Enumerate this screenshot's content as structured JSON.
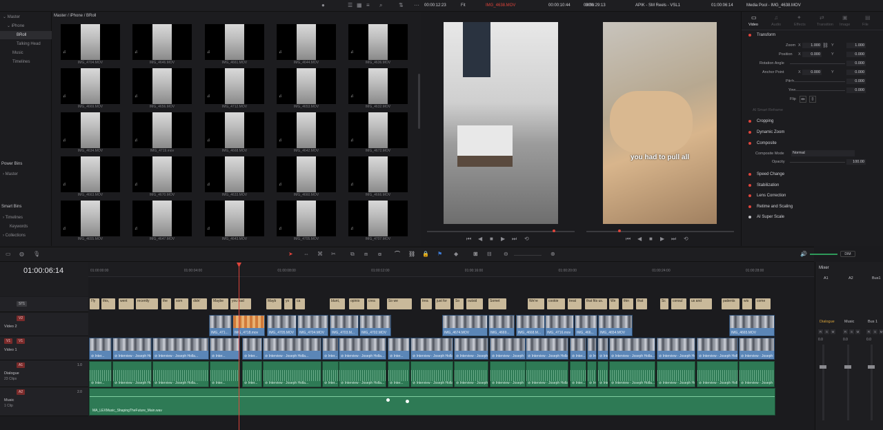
{
  "topbar": {
    "left_timecode": "00:00:12:23",
    "left_clip": "IMG_4638.MOV",
    "left_duration": "00:00:10:44",
    "fit_label": "Fit",
    "right_timecode": "00:00:29:13",
    "zoom": "30%",
    "timeline_name": "APIK - SM Reels - VSL1",
    "right_duration": "01:00:06:14",
    "inspector_title": "Media Pool - IMG_4638.MOV"
  },
  "sidebar": {
    "items": [
      {
        "label": "Master",
        "indent": 0
      },
      {
        "label": "iPhone",
        "indent": 1
      },
      {
        "label": "BRoll",
        "indent": 2,
        "selected": true
      },
      {
        "label": "Talking Head",
        "indent": 2
      },
      {
        "label": "Music",
        "indent": 1
      },
      {
        "label": "Timelines",
        "indent": 1
      }
    ],
    "power_bins_title": "Power Bins",
    "power_bins_items": [
      "Master"
    ],
    "smart_bins_title": "Smart Bins",
    "smart_bins_items": [
      "Timelines",
      "Keywords",
      "Collections"
    ]
  },
  "media_pool": {
    "breadcrumb": "Master / iPhone / BRoll",
    "clips": [
      "IMG_4704.MOV",
      "IMG_4646.MOV",
      "IMG_4661.MOV",
      "IMG_4644.MOV",
      "IMG_4636.MOV",
      "IMG_4669.MOV",
      "IMG_4656.MOV",
      "IMG_4712.MOV",
      "IMG_4653.MOV",
      "IMG_4632.MOV",
      "IMG_4634.MOV",
      "IMG_4719.mov",
      "IMG_4668.MOV",
      "IMG_4642.MOV",
      "IMG_4672.MOV",
      "IMG_4663.MOV",
      "IMG_4670.MOV",
      "IMG_4633.MOV",
      "IMG_4660.MOV",
      "IMG_4666.MOV",
      "IMG_4655.MOV",
      "IMG_4647.MOV",
      "IMG_4643.MOV",
      "IMG_4705.MOV",
      "IMG_4707.MOV"
    ]
  },
  "viewer": {
    "subtitle_overlay": "you had to pull all"
  },
  "inspector": {
    "tabs": [
      "Video",
      "Audio",
      "Effects",
      "Transition",
      "Image",
      "File"
    ],
    "transform_title": "Transform",
    "zoom_label": "Zoom",
    "zoom_x": "1.000",
    "zoom_y": "1.000",
    "position_label": "Position",
    "position_x": "0.000",
    "position_y": "0.000",
    "rotation_label": "Rotation Angle",
    "rotation_val": "0.000",
    "anchor_label": "Anchor Point",
    "anchor_x": "0.000",
    "anchor_y": "0.000",
    "pitch_label": "Pitch",
    "pitch_val": "0.000",
    "yaw_label": "Yaw",
    "yaw_val": "0.000",
    "flip_label": "Flip",
    "ai_smart_reframe": "AI Smart Reframe",
    "cropping": "Cropping",
    "dynamic_zoom": "Dynamic Zoom",
    "composite": "Composite",
    "composite_mode_label": "Composite Mode",
    "composite_mode_val": "Normal",
    "opacity_label": "Opacity",
    "opacity_val": "100.00",
    "speed_change": "Speed Change",
    "stabilization": "Stabilization",
    "lens_correction": "Lens Correction",
    "retime_scaling": "Retime and Scaling",
    "ai_super_scale": "AI Super Scale"
  },
  "timeline": {
    "current_timecode": "01:00:06:14",
    "ruler": [
      "01:00:00:00",
      "01:00:04:00",
      "01:00:08:00",
      "01:00:12:00",
      "01:00:16:00",
      "01:00:20:00",
      "01:00:24:00",
      "01:00:28:00"
    ],
    "dim_label": "DIM",
    "tracks": {
      "st1": "ST1",
      "v2": "V2",
      "v2_name": "Video 2",
      "v1": "V1",
      "v1_name": "Video 1",
      "a1": "A1",
      "a1_name": "Dialogue",
      "a1_count": "23 Clips",
      "a1_level": "1.0",
      "a2": "A2",
      "a2_name": "Music",
      "a2_count": "1 Clip",
      "a2_level": "2.0"
    },
    "subtitles": [
      "I'fy",
      "this,",
      "went",
      "recently",
      "the",
      "som",
      "didn'",
      "Maybe",
      "you had",
      "Mayb",
      "yo",
      "ca",
      "blunt,",
      "opinio",
      "crea",
      "So we",
      "trea",
      "just for",
      "So",
      "outsid",
      "Somet",
      "We're",
      "cookie",
      "treat",
      "that fits us.",
      "We",
      "thin",
      "that",
      "Sc",
      "consul",
      "us and",
      "patients",
      "wis",
      "come"
    ],
    "v2_clips": [
      "IMG_471...",
      "IMG_4718.mov",
      "IMG_4705.MOV",
      "IMG_4704.MOV",
      "IMG_4703.M...",
      "IMG_4702.MOV",
      "IMG_4674.MOV",
      "IMG_4669...",
      "IMG_4668.M...",
      "IMG_4716.mov",
      "IMG_466...",
      "IMG_4654.MOV",
      "IMG_4665.MOV"
    ],
    "v1_clip_label": "Interview - Joseph Holla...",
    "v1_short": "Inter...",
    "a1_clip_label": "Interview - Joseph Holla...",
    "a2_clip_label": "MA_LEXMusic_ShapingTheFuture_Main.wav"
  },
  "mixer": {
    "title": "Mixer",
    "channels": [
      "A1",
      "A2",
      "Bus1"
    ],
    "names": [
      "Dialogue",
      "Music",
      "Bus 1"
    ],
    "levels": [
      "0.0",
      "0.0",
      "0.0"
    ]
  }
}
